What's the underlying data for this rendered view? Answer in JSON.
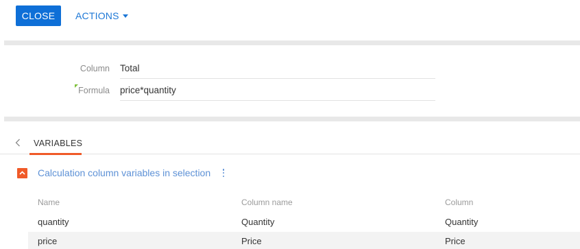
{
  "toolbar": {
    "close_label": "CLOSE",
    "actions_label": "ACTIONS"
  },
  "form": {
    "column": {
      "label": "Column",
      "value": "Total"
    },
    "formula": {
      "label": "Formula",
      "value": "price*quantity"
    }
  },
  "tabs": {
    "items": [
      {
        "label": "VARIABLES",
        "active": true
      }
    ]
  },
  "detail": {
    "title": "Calculation column variables in selection",
    "columns": [
      "Name",
      "Column name",
      "Column"
    ],
    "rows": [
      {
        "name": "quantity",
        "column_name": "Quantity",
        "column": "Quantity"
      },
      {
        "name": "price",
        "column_name": "Price",
        "column": "Price"
      }
    ]
  },
  "colors": {
    "primary": "#0e6fd7",
    "link": "#1c77d6",
    "accent": "#f05a28",
    "required": "#7ec13a"
  },
  "icons": {
    "back": "chevron-left-icon",
    "actions_caret": "caret-down-icon",
    "collapse": "chevron-up-icon",
    "menu": "kebab-vertical-icon"
  }
}
